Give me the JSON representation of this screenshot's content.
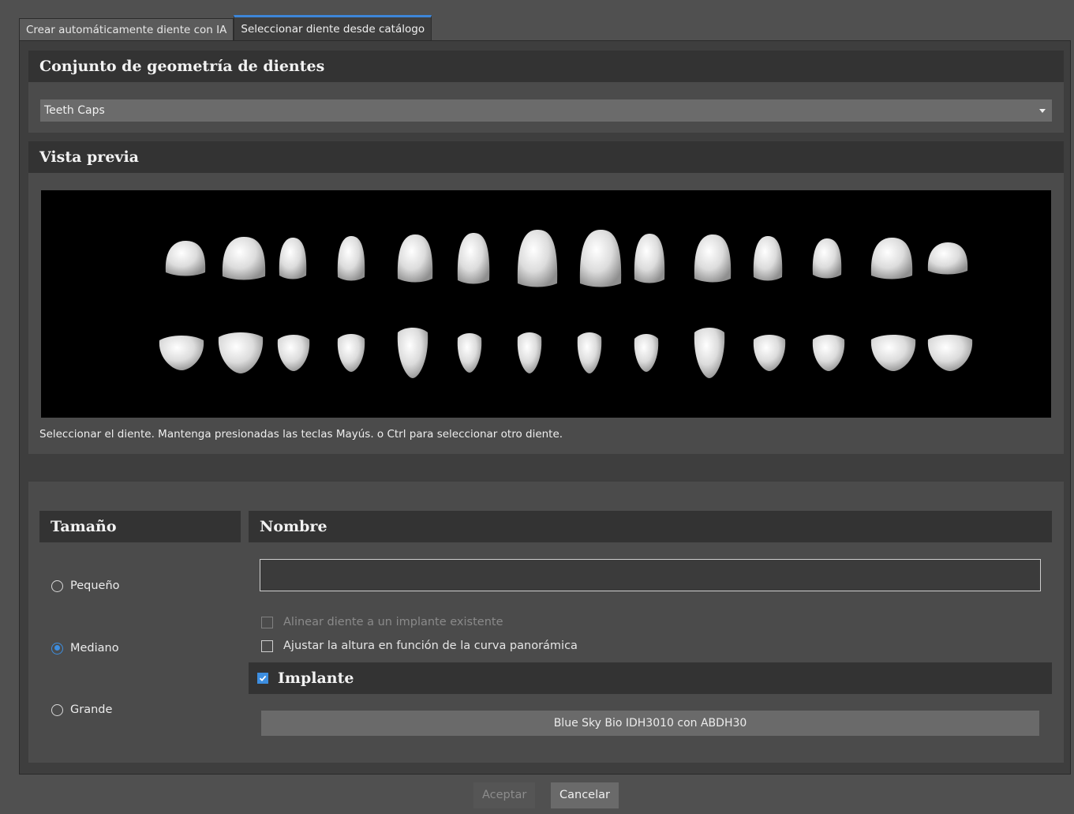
{
  "tabs": [
    {
      "label": "Crear automáticamente diente con IA",
      "active": false
    },
    {
      "label": "Seleccionar diente desde catálogo",
      "active": true
    }
  ],
  "geometry": {
    "title": "Conjunto de geometría de dientes",
    "selected": "Teeth Caps"
  },
  "preview": {
    "title": "Vista previa",
    "hint": "Seleccionar el diente. Mantenga presionadas las teclas Mayús. o Ctrl para seleccionar otro diente."
  },
  "size": {
    "title": "Tamaño",
    "options": [
      "Pequeño",
      "Mediano",
      "Grande"
    ],
    "selected": "Mediano"
  },
  "name": {
    "title": "Nombre",
    "value": "",
    "align_label": "Alinear diente a un implante existente",
    "align_checked": false,
    "align_enabled": false,
    "adjust_label": "Ajustar la altura en función de la curva panorámica",
    "adjust_checked": false
  },
  "implant": {
    "title": "Implante",
    "checked": true,
    "button_label": "Blue Sky Bio IDH3010 con ABDH30"
  },
  "footer": {
    "accept_label": "Aceptar",
    "accept_enabled": false,
    "cancel_label": "Cancelar"
  },
  "colors": {
    "accent": "#3d8ee0",
    "tooth": "#e8e8e8"
  }
}
